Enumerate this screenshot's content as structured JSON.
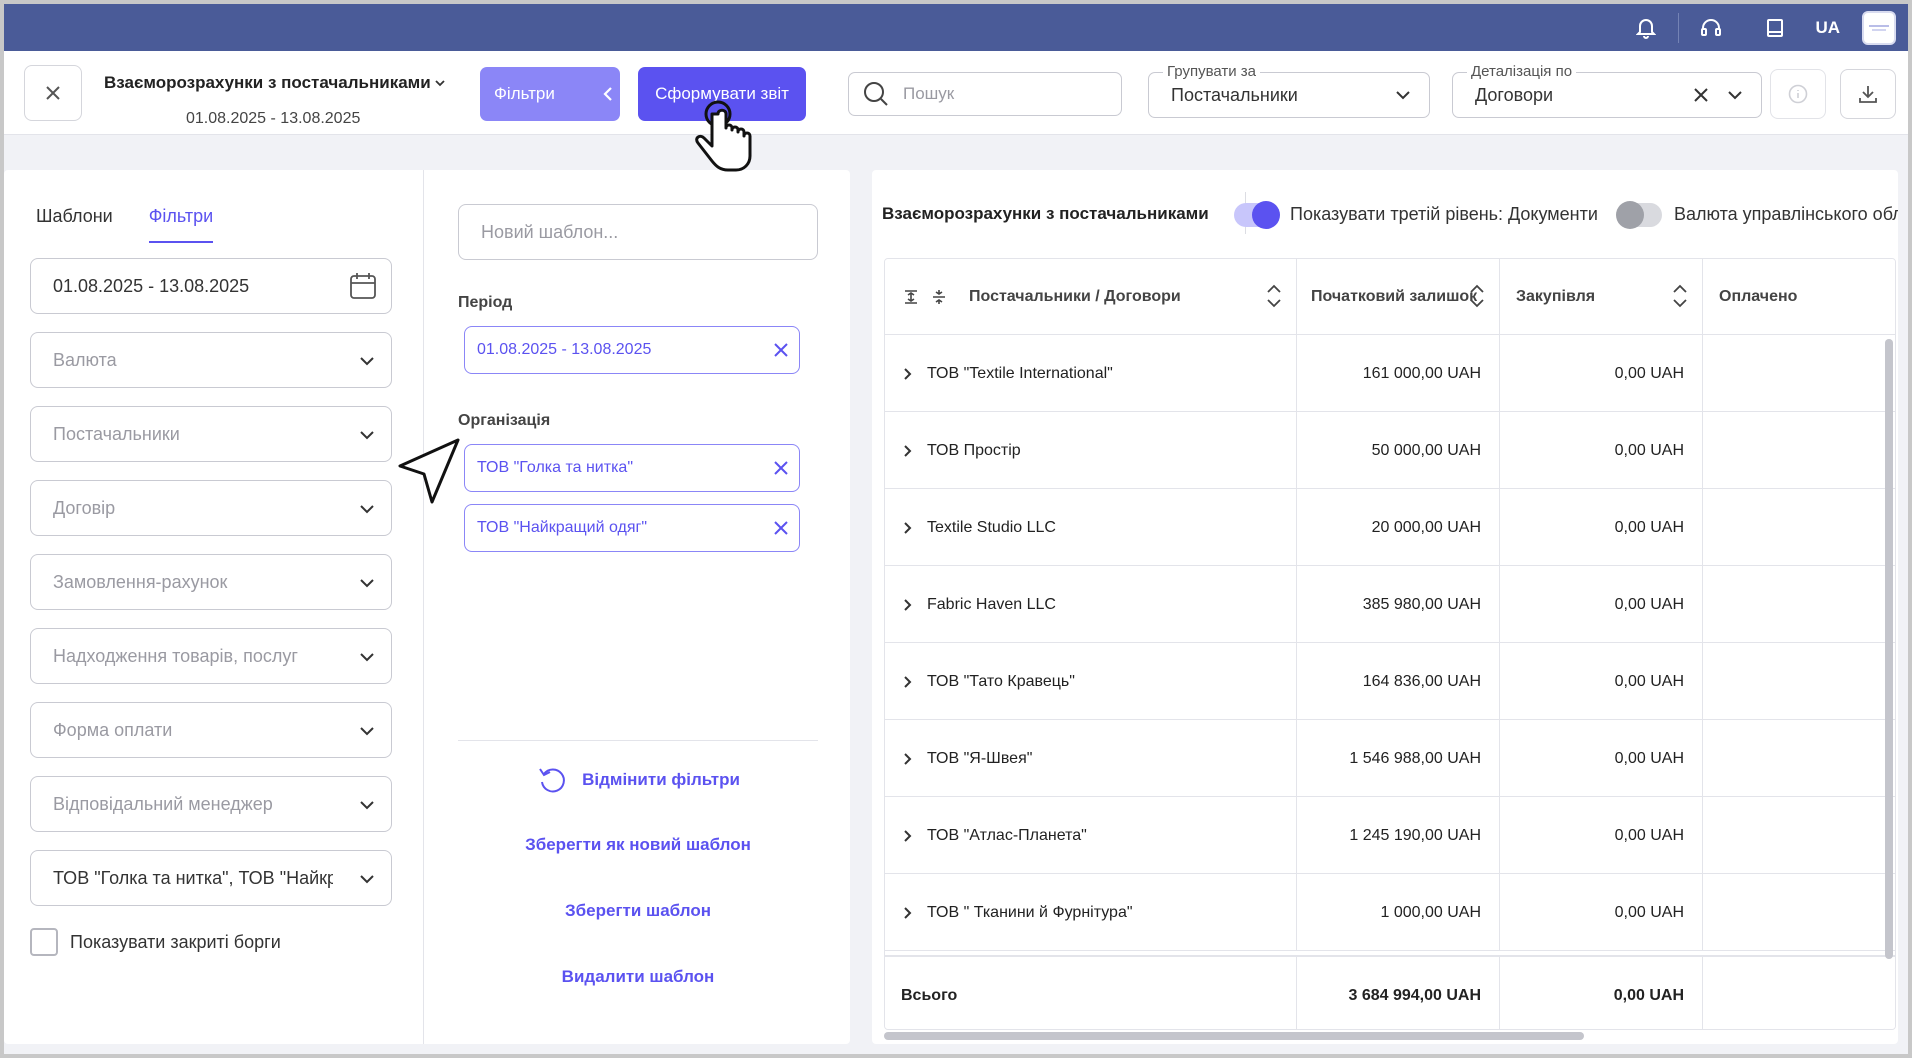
{
  "topbar": {
    "lang": "UA",
    "icons": [
      "bell-icon",
      "headset-icon",
      "book-icon"
    ]
  },
  "header": {
    "title": "Взаєморозрахунки з постачальниками",
    "period": "01.08.2025 - 13.08.2025",
    "filters_btn": "Фільтри",
    "generate_btn": "Сформувати звіт",
    "search_placeholder": "Пошук",
    "group_by": {
      "legend": "Групувати за",
      "value": "Постачальники"
    },
    "detail_by": {
      "legend": "Деталізація по",
      "value": "Договори"
    }
  },
  "left": {
    "tabs": [
      "Шаблони",
      "Фільтри"
    ],
    "active_tab": "Фільтри",
    "date_range": "01.08.2025 - 13.08.2025",
    "fields": [
      "Валюта",
      "Постачальники",
      "Договір",
      "Замовлення-рахунок",
      "Надходження товарів, послуг",
      "Форма оплати",
      "Відповідальний менеджер"
    ],
    "organization_value": "ТОВ \"Голка та нитка\", ТОВ \"Найкращий одяг\"",
    "show_closed_debts": "Показувати закриті борги"
  },
  "middle": {
    "template_placeholder": "Новий шаблон...",
    "period_label": "Період",
    "period_chip": "01.08.2025 - 13.08.2025",
    "org_label": "Організація",
    "org_chips": [
      "ТОВ \"Голка та нитка\"",
      "ТОВ \"Найкращий одяг\""
    ],
    "reset_filters": "Відмінити фільтри",
    "save_as_new": "Зберегти як новий шаблон",
    "save_template": "Зберегти шаблон",
    "delete_template": "Видалити шаблон"
  },
  "right": {
    "title": "Взаєморозрахунки з постачальниками",
    "toggle_third_level": {
      "label": "Показувати третій рівень: Документи",
      "on": true
    },
    "toggle_currency": {
      "label": "Валюта управлінського обліку",
      "on": false
    },
    "columns": [
      "Постачальники / Договори",
      "Початковий залишок",
      "Закупівля",
      "Оплачено"
    ],
    "rows": [
      {
        "name": "ТОВ \"Textile International\"",
        "opening": "161 000,00 UAH",
        "purchase": "0,00 UAH"
      },
      {
        "name": "ТОВ Простір",
        "opening": "50 000,00 UAH",
        "purchase": "0,00 UAH"
      },
      {
        "name": "Textile Studio LLC",
        "opening": "20 000,00 UAH",
        "purchase": "0,00 UAH"
      },
      {
        "name": "Fabric Haven LLC",
        "opening": "385 980,00 UAH",
        "purchase": "0,00 UAH"
      },
      {
        "name": "ТОВ \"Тато Кравець\"",
        "opening": "164 836,00 UAH",
        "purchase": "0,00 UAH"
      },
      {
        "name": "ТОВ \"Я-Швея\"",
        "opening": "1 546 988,00 UAH",
        "purchase": "0,00 UAH"
      },
      {
        "name": "ТОВ \"Атлас-Планета\"",
        "opening": "1 245 190,00 UAH",
        "purchase": "0,00 UAH"
      },
      {
        "name": "ТОВ \" Тканини й Фурнітура\"",
        "opening": "1 000,00 UAH",
        "purchase": "0,00 UAH"
      }
    ],
    "total": {
      "label": "Всього",
      "opening": "3 684 994,00 UAH",
      "purchase": "0,00 UAH"
    }
  },
  "colors": {
    "topbar": "#4a5b98",
    "accent": "#5b52f0",
    "accent_light": "#8b86f7"
  }
}
